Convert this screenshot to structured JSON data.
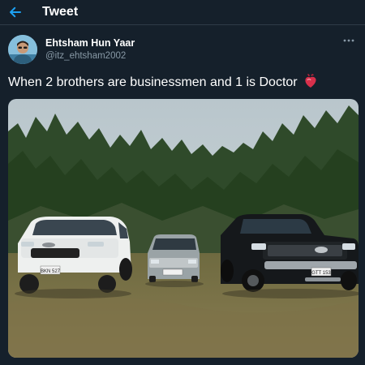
{
  "header": {
    "title": "Tweet",
    "back_icon": "arrow-left-icon"
  },
  "author": {
    "display_name": "Ehtsham Hun Yaar",
    "handle": "@itz_ehtsham2002"
  },
  "tweet": {
    "text": "When 2 brothers are businessmen and 1 is Doctor",
    "emoji": "anatomical-heart-emoji"
  },
  "media": {
    "plates": {
      "left": "BKN 527",
      "middle": "",
      "right": "GTT 153"
    }
  },
  "colors": {
    "background": "#15202b",
    "accent": "#1da1f2",
    "muted": "#8899a6"
  }
}
